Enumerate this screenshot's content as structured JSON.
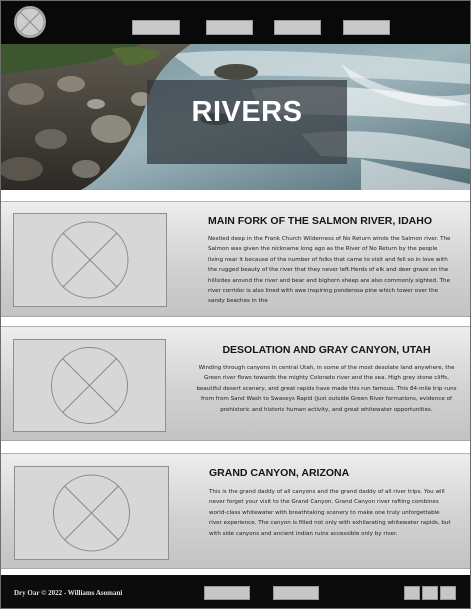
{
  "hero": {
    "title": "RIVERS"
  },
  "nav": {
    "buttons": [
      "",
      "",
      "",
      ""
    ]
  },
  "cards": [
    {
      "title": "MAIN FORK OF THE SALMON RIVER, IDAHO",
      "body": "Nestled deep in the Frank Church Wilderness of No Return winds the Salmon river. The Salmon was given the nickname long ago as the River of No Return by the people living near it because of the number of folks that came to visit and fell so in love with the rugged beauty of the river that they never left.Herds of elk and deer graze on the hillsides around the river and bear and bighorn sheep are also commonly sighted. The river corridor is also lined with awe inspiring ponderosa pine which tower over the sandy beaches in the"
    },
    {
      "title": "DESOLATION AND GRAY CANYON, UTAH",
      "body": "Winding through canyons in central Utah, in some of the most desolate land anywhere, the Green river flows towards the mighty Colorado river and the sea. High grey stone cliffs, beautiful desert scenery, and great rapids have made this run famous. This 84-mile trip runs from from Sand Wash to Swaseys Rapid (just outside Green River formations, evidence of prehistoric and historic human activity, and great whitewater opportunities."
    },
    {
      "title": "GRAND CANYON, ARIZONA",
      "body": "This is the grand daddy of all canyons and the grand daddy of all river trips. You will never forget your visit to the Grand Canyon. Grand Canyon river rafting combines world-class whitewater with breathtaking scenery to make one truly unforgettable river experience. The canyon is filled not only with exhilarating whitewater rapids, but with side canyons and ancient indian ruins accessible only by river."
    }
  ],
  "footer": {
    "copyright": "Dry Oar © 2022 - Williams Asomani"
  },
  "colors": {
    "topbar": "#090909",
    "footer": "#0c0c0c",
    "card_gradient_top": "#ededed",
    "card_gradient_bottom": "#c3c3c3",
    "hero_overlay": "#30383c"
  },
  "icons": {
    "logo": "placeholder-circle-x-icon",
    "thumbnails": "image-placeholder-icon"
  }
}
